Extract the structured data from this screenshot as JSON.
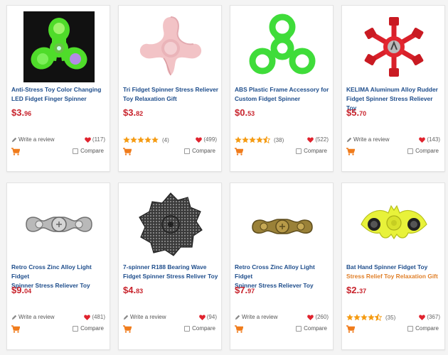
{
  "colors": {
    "title_link": "#1f4e8c",
    "price": "#c8232c",
    "accent_orange": "#f07c1c",
    "heart": "#e0232e",
    "star": "#f59b12"
  },
  "products": [
    {
      "title_line1": "Anti-Stress Toy Color Changing",
      "title_line2": "LED Fidget Finger Spinner",
      "price_main": "$3.",
      "price_cents": "96",
      "rating": null,
      "rating_count": "",
      "write_review": "Write a review",
      "likes": "(117)",
      "compare": "Compare",
      "image": "led-spinner"
    },
    {
      "title_line1": "Tri Fidget Spinner Stress Reliever",
      "title_line2": "Toy Relaxation Gift",
      "price_main": "$3.",
      "price_cents": "82",
      "rating": 5,
      "rating_count": "(4)",
      "write_review": "",
      "likes": "(499)",
      "compare": "Compare",
      "image": "pink-spinner"
    },
    {
      "title_line1": "ABS Plastic Frame Accessory for",
      "title_line2": "Custom Fidget Spinner",
      "price_main": "$0.",
      "price_cents": "53",
      "rating": 4.5,
      "rating_count": "(38)",
      "write_review": "",
      "likes": "(522)",
      "compare": "Compare",
      "image": "green-frame"
    },
    {
      "title_line1": "KELIMA Aluminum Alloy Rudder",
      "title_line2": "Fidget Spinner Stress Reliever Toy",
      "price_main": "$5.",
      "price_cents": "70",
      "rating": null,
      "rating_count": "",
      "write_review": "Write a review",
      "likes": "(143)",
      "compare": "Compare",
      "image": "red-rudder"
    },
    {
      "title_line1": "Retro Cross Zinc Alloy Light Fidget",
      "title_line2": "Spinner Stress Reliever Toy",
      "price_main": "$9.",
      "price_cents": "04",
      "rating": null,
      "rating_count": "",
      "write_review": "Write a review",
      "likes": "(481)",
      "compare": "Compare",
      "image": "silver-bar"
    },
    {
      "title_line1": "7-spinner R188 Bearing Wave",
      "title_line2": "Fidget Spinner Stress Reliver Toy",
      "price_main": "$4.",
      "price_cents": "83",
      "rating": null,
      "rating_count": "",
      "write_review": "Write a review",
      "likes": "(94)",
      "compare": "Compare",
      "image": "wave-spinner"
    },
    {
      "title_line1": "Retro Cross Zinc Alloy Light Fidget",
      "title_line2": "Spinner Stress Reliever Toy",
      "price_main": "$7.",
      "price_cents": "97",
      "rating": null,
      "rating_count": "",
      "write_review": "Write a review",
      "likes": "(260)",
      "compare": "Compare",
      "image": "brass-bar"
    },
    {
      "title_line1": "Bat Hand Spinner Fidget Toy",
      "title_line2": "Stress Relief Toy Relaxation Gift",
      "title_line2_orange": true,
      "price_main": "$2.",
      "price_cents": "37",
      "rating": 4.5,
      "rating_count": "(35)",
      "write_review": "",
      "likes": "(367)",
      "compare": "Compare",
      "image": "bat-spinner"
    }
  ]
}
